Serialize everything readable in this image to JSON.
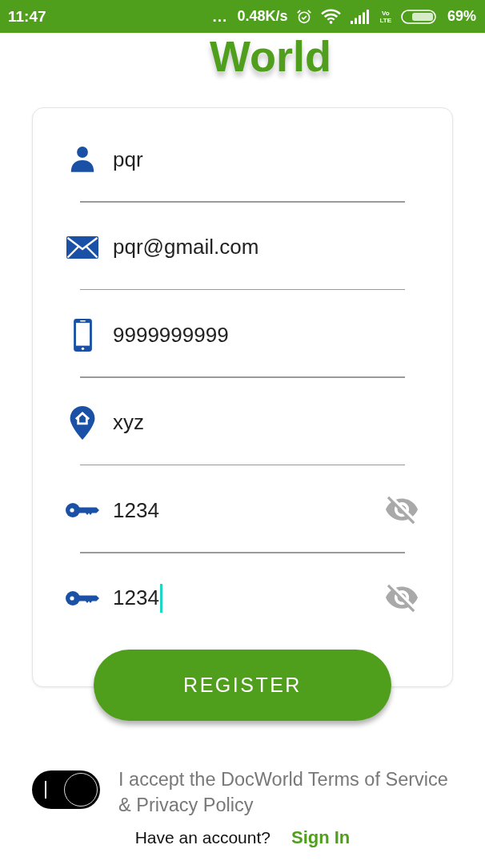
{
  "status_bar": {
    "time": "11:47",
    "overflow_dots": "...",
    "net_speed": "0.48K/s",
    "network_type": [
      "Vo",
      "LTE"
    ],
    "battery": "69%"
  },
  "logo": "World",
  "form": {
    "fields": [
      {
        "kind": "name",
        "value": "pqr",
        "focused": false
      },
      {
        "kind": "email",
        "value": "pqr@gmail.com",
        "focused": false
      },
      {
        "kind": "phone",
        "value": "9999999999",
        "focused": false
      },
      {
        "kind": "address",
        "value": "xyz",
        "focused": false
      },
      {
        "kind": "password",
        "value": "1234",
        "focused": false
      },
      {
        "kind": "password",
        "value": "1234",
        "focused": true
      }
    ],
    "submit": "REGISTER"
  },
  "terms": {
    "accepted": true,
    "text": "I accept the DocWorld Terms of Service & Privacy Policy"
  },
  "footer": {
    "prompt": "Have an account?",
    "link": "Sign In"
  }
}
